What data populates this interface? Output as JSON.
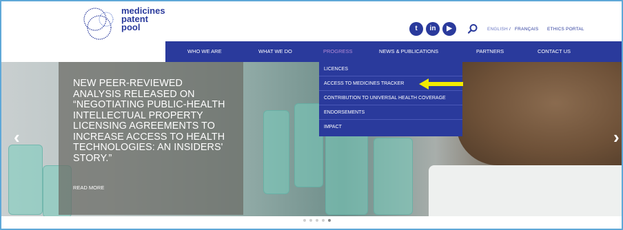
{
  "logo": {
    "line1": "medicines",
    "line2": "patent",
    "line3": "pool"
  },
  "social": [
    {
      "name": "twitter",
      "glyph": "t"
    },
    {
      "name": "linkedin",
      "glyph": "in"
    },
    {
      "name": "youtube",
      "glyph": "▶"
    }
  ],
  "header_links": {
    "english": "ENGLISH",
    "separator": "/",
    "francais": "FRANÇAIS",
    "ethics": "ETHICS PORTAL"
  },
  "nav": [
    {
      "label": "WHO WE ARE"
    },
    {
      "label": "WHAT WE DO"
    },
    {
      "label": "PROGRESS"
    },
    {
      "label": "NEWS & PUBLICATIONS"
    },
    {
      "label": "PARTNERS"
    },
    {
      "label": "CONTACT US"
    }
  ],
  "dropdown": [
    {
      "label": "LICENCES"
    },
    {
      "label": "ACCESS TO MEDICINES TRACKER"
    },
    {
      "label": "CONTRIBUTION TO UNIVERSAL HEALTH COVERAGE"
    },
    {
      "label": "ENDORSEMENTS"
    },
    {
      "label": "IMPACT"
    }
  ],
  "hero": {
    "headline_lines": [
      "NEW PEER-REVIEWED",
      "ANALYSIS RELEASED ON",
      "“NEGOTIATING PUBLIC-HEALTH",
      "INTELLECTUAL PROPERTY",
      "LICENSING AGREEMENTS TO",
      "INCREASE ACCESS TO HEALTH",
      "TECHNOLOGIES: AN INSIDERS'",
      "STORY.”"
    ],
    "read_more": "READ MORE",
    "prev": "‹",
    "next": "›",
    "slide_count": 5,
    "active_slide": 5
  },
  "colors": {
    "brand": "#2a3a9c",
    "active_nav": "#b48ad6",
    "highlight_arrow": "#f2ea00",
    "frame": "#5fa8d8"
  }
}
